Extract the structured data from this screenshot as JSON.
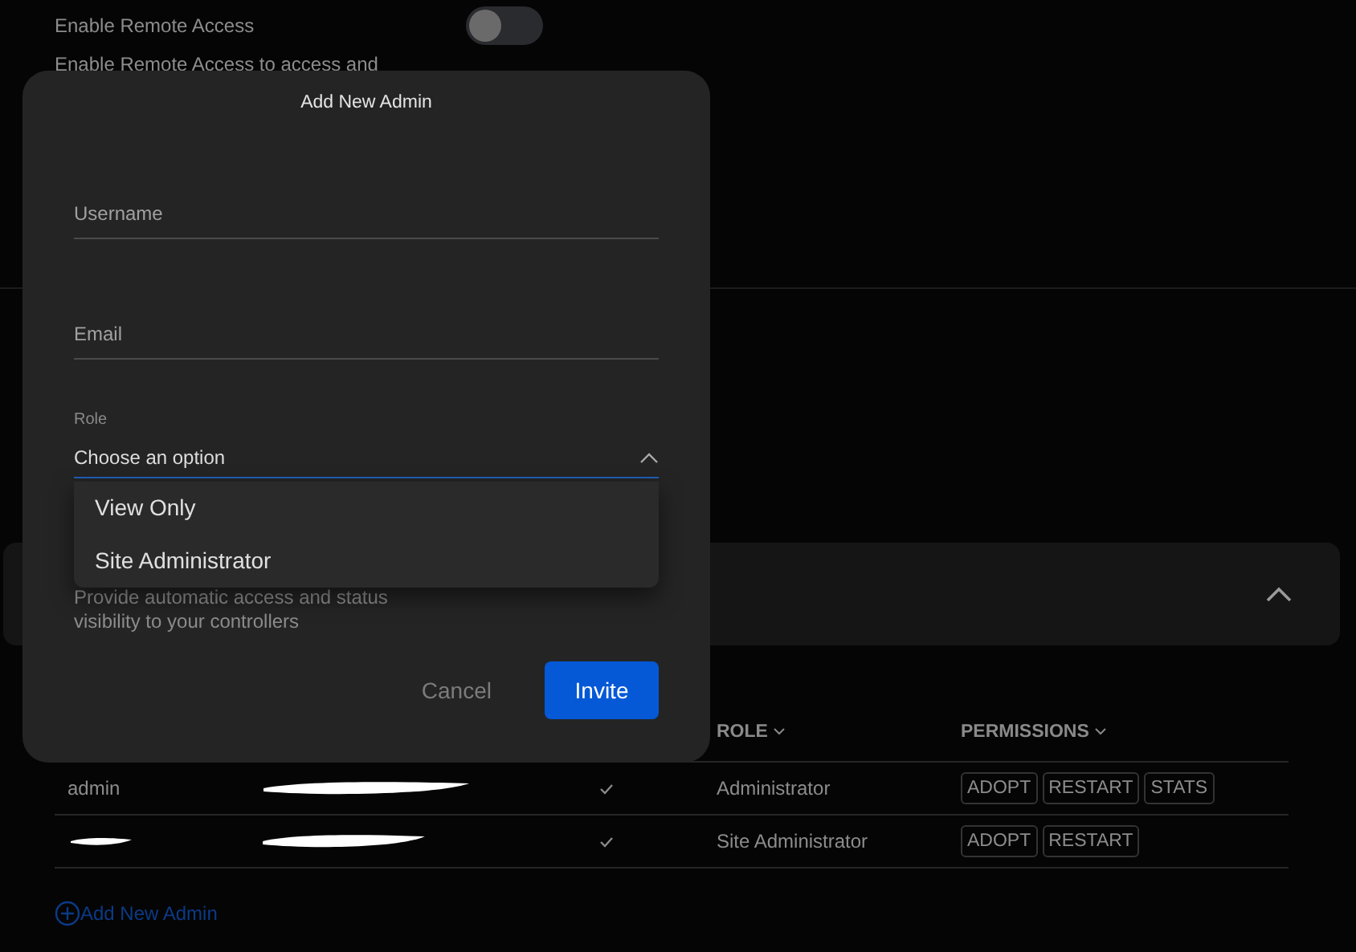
{
  "background": {
    "remote_access": {
      "label": "Enable Remote Access",
      "on": false,
      "description": "Enable Remote Access to access and"
    },
    "card": {
      "description": [
        "Provide automatic access and status",
        "visibility to your controllers"
      ],
      "expanded": true
    },
    "admins_table": {
      "columns": [
        {
          "label": "ROLE"
        },
        {
          "label": "PERMISSIONS"
        }
      ],
      "rows": [
        {
          "name": "admin",
          "verified": true,
          "role": "Administrator",
          "permissions": [
            "ADOPT",
            "RESTART",
            "STATS"
          ]
        },
        {
          "verified": true,
          "role": "Site Administrator",
          "permissions": [
            "ADOPT",
            "RESTART"
          ]
        }
      ]
    },
    "add_link": "Add New Admin"
  },
  "dialog": {
    "title": "Add New Admin",
    "fields": [
      {
        "placeholder": "Username"
      },
      {
        "placeholder": "Email"
      }
    ],
    "role": {
      "label": "Role",
      "value": "Choose an option",
      "open": true,
      "options": [
        {
          "label": "View Only",
          "selected": false
        },
        {
          "label": "Site Administrator",
          "selected": false
        }
      ]
    },
    "buttons": [
      {
        "label": "Cancel",
        "kind": "secondary"
      },
      {
        "label": "Invite",
        "kind": "primary"
      }
    ]
  }
}
